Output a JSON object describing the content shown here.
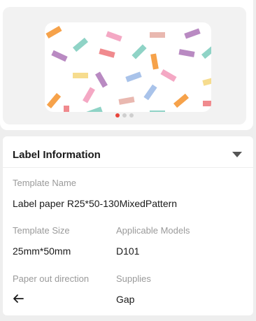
{
  "preview": {
    "pattern_colors": [
      "#f4a8c4",
      "#8fd3c6",
      "#f6a24a",
      "#b98ac2",
      "#a9c3ea",
      "#f6dc8e",
      "#f08a8e",
      "#e9b8b0"
    ],
    "page_indicator": {
      "total": 3,
      "active": 1
    },
    "indicator_active_color": "#e8453c",
    "indicator_inactive_color": "#cfcfcf"
  },
  "info": {
    "title": "Label Information",
    "expand_icon": "triangle-down-icon",
    "template_name": {
      "label": "Template Name",
      "value": "Label paper R25*50-130MixedPattern"
    },
    "template_size": {
      "label": "Template Size",
      "value": "25mm*50mm"
    },
    "applicable_models": {
      "label": "Applicable Models",
      "value": "D101"
    },
    "paper_out_direction": {
      "label": "Paper out direction",
      "icon": "arrow-left-icon"
    },
    "supplies": {
      "label": "Supplies",
      "value": "Gap"
    }
  }
}
